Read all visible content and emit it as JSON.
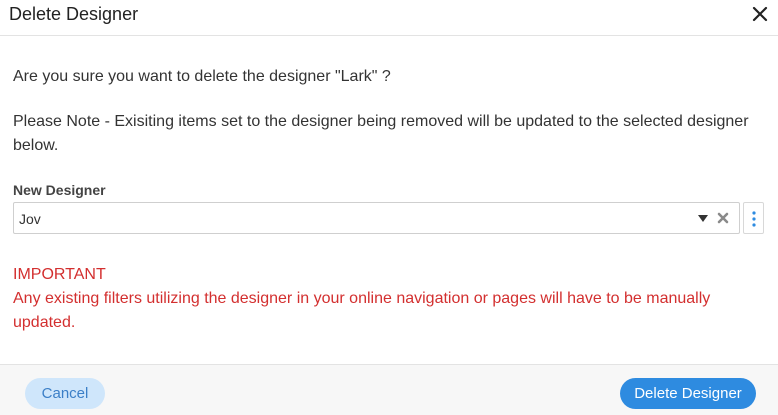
{
  "dialog": {
    "title": "Delete Designer",
    "close_icon": "close-icon"
  },
  "body": {
    "question": "Are you sure you want to delete the designer \"Lark\" ?",
    "note": "Please Note - Exisiting items set to the designer being removed will be updated to the selected designer below."
  },
  "field": {
    "label": "New Designer",
    "value": "Jov",
    "arrow_icon": "dropdown-arrow-icon",
    "clear_icon": "clear-icon",
    "more_icon": "more-vertical-icon"
  },
  "warning": {
    "heading": "IMPORTANT",
    "text": "Any existing filters utilizing the designer in your online navigation or pages will have to be manually updated."
  },
  "footer": {
    "cancel_label": "Cancel",
    "delete_label": "Delete Designer"
  },
  "colors": {
    "warning": "#d32f2f",
    "primary": "#2e8be0",
    "secondary_bg": "#cfe6fb"
  }
}
